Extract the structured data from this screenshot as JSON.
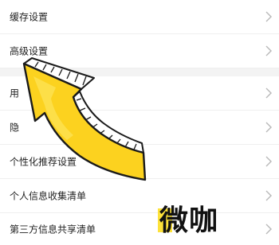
{
  "settings": {
    "rows": [
      {
        "label": "缓存设置"
      },
      {
        "label": "高级设置"
      },
      {
        "label": "用"
      },
      {
        "label": "隐"
      },
      {
        "label": "个性化推荐设置"
      },
      {
        "label": "个人信息收集清单"
      },
      {
        "label": "第三方信息共享清单"
      }
    ]
  },
  "overlay": {
    "arrow_icon": "curved-arrow-pointing-up-left",
    "arrow_color": "#fcd21f"
  },
  "watermark": {
    "text": "微咖",
    "accent_color": "#fde23a"
  }
}
